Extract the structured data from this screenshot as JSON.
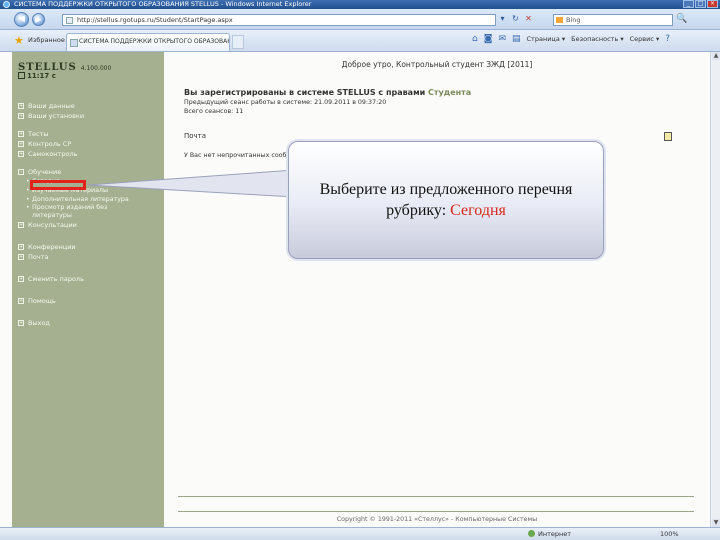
{
  "window": {
    "title": "СИСТЕМА ПОДДЕРЖКИ ОТКРЫТОГО ОБРАЗОВАНИЯ   STELLUS - Windows Internet Explorer",
    "controls": [
      "_",
      "□",
      "×"
    ]
  },
  "address_bar": {
    "url": "http://stellus.rgotups.ru/Student/StartPage.aspx",
    "search_placeholder": "Bing",
    "tools": [
      "▾",
      "↻",
      "✕"
    ],
    "search_go": "🔍"
  },
  "favorites": {
    "label": "Избранное"
  },
  "tab": {
    "label": "СИСТЕМА ПОДДЕРЖКИ ОТКРЫТОГО ОБРАЗОВАНИЯ"
  },
  "command_bar": {
    "items": [
      "Страница ▾",
      "Безопасность ▾",
      "Сервис ▾"
    ],
    "icons": [
      "home-icon",
      "rss-icon",
      "mail-icon",
      "print-icon",
      "help-icon"
    ]
  },
  "sidebar": {
    "logo": "STELLUS",
    "logo_version": "4.100.000",
    "clock": "11:17 с",
    "menu_top": [
      {
        "label": "Ваши данные",
        "marker": "+"
      },
      {
        "label": "Ваши установки",
        "marker": "+"
      }
    ],
    "menu_mid": [
      {
        "label": "Тесты",
        "marker": "+"
      },
      {
        "label": "Контроль СР",
        "marker": "+"
      },
      {
        "label": "Самоконтроль",
        "marker": "+"
      }
    ],
    "training": {
      "label": "Обучение",
      "marker": "-",
      "items": [
        {
          "label": "Сегодня"
        },
        {
          "label": "Изучаемые материалы"
        },
        {
          "label": "Дополнительная литература"
        },
        {
          "label": "Просмотр изданий без литературы"
        }
      ]
    },
    "menu_after": [
      {
        "label": "Консультации",
        "marker": "+"
      }
    ],
    "menu_bottom_1": [
      {
        "label": "Конференции",
        "marker": "+"
      },
      {
        "label": "Почта",
        "marker": "+"
      }
    ],
    "menu_bottom_2": [
      {
        "label": "Сменить пароль",
        "marker": "+"
      }
    ],
    "menu_bottom_3": [
      {
        "label": "Помощь",
        "marker": "+"
      }
    ],
    "menu_bottom_4": [
      {
        "label": "Выход",
        "marker": "+"
      }
    ]
  },
  "main": {
    "greeting": "Доброе утро, Контрольный студент ЗЖД [2011]",
    "registration_title": "Вы зарегистрированы в системе STELLUS с правами",
    "registration_role": "Студента",
    "previous_session": "Предыдущий сеанс работы в системе: 21.09.2011 в 09:37:20",
    "session_number": "Всего сеансов: 11",
    "mail_section": "Почта",
    "mail_note": "У Вас нет непрочитанных сообщений",
    "copyright": "Copyright © 1991-2011 «Стеллус» - Компьютерные Системы"
  },
  "callout": {
    "text": "Выберите из предложенного перечня рубрику:",
    "highlight": "Сегодня"
  },
  "status_bar": {
    "status": "",
    "zone": "Интернет",
    "zoom": "100%"
  }
}
